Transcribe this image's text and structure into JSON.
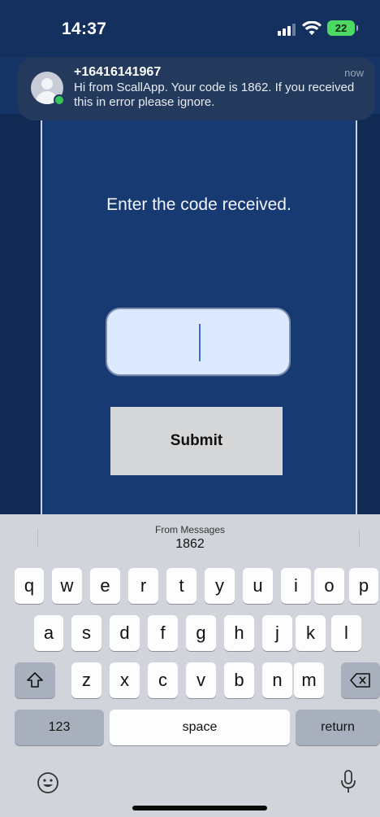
{
  "status_bar": {
    "time": "14:37",
    "battery": "22"
  },
  "notification": {
    "sender": "+16416141967",
    "time": "now",
    "message": "Hi from ScallApp. Your code is 1862. If you received this in error please ignore."
  },
  "app": {
    "prompt": "Enter the code received.",
    "code_input_value": "",
    "submit_label": "Submit"
  },
  "keyboard": {
    "suggestion_source": "From Messages",
    "suggestion_code": "1862",
    "row1": [
      "q",
      "w",
      "e",
      "r",
      "t",
      "y",
      "u",
      "i",
      "o",
      "p"
    ],
    "row2": [
      "a",
      "s",
      "d",
      "f",
      "g",
      "h",
      "j",
      "k",
      "l"
    ],
    "row3": [
      "z",
      "x",
      "c",
      "v",
      "b",
      "n",
      "m"
    ],
    "numbers_label": "123",
    "space_label": "space",
    "return_label": "return",
    "icons": {
      "shift": "shift-icon",
      "delete": "delete-icon",
      "emoji": "emoji-icon",
      "mic": "microphone-icon"
    }
  }
}
